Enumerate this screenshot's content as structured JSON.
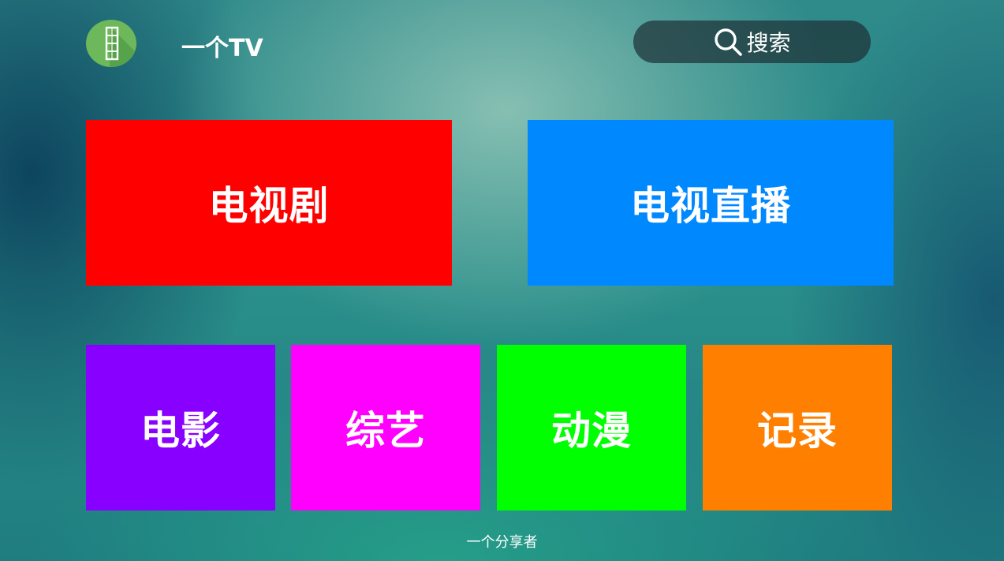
{
  "header": {
    "app_title": "一个TV",
    "logo_icon": "film-strip-icon",
    "search_label": "搜索",
    "search_icon": "search-icon"
  },
  "tiles": {
    "tv_series": {
      "label": "电视剧",
      "color": "#ff0000"
    },
    "live_tv": {
      "label": "电视直播",
      "color": "#0088ff"
    },
    "movies": {
      "label": "电影",
      "color": "#8800ff"
    },
    "variety": {
      "label": "综艺",
      "color": "#ff00ff"
    },
    "anime": {
      "label": "动漫",
      "color": "#00ff00"
    },
    "documentary": {
      "label": "记录",
      "color": "#ff8000"
    }
  },
  "footer": {
    "text": "一个分享者"
  }
}
